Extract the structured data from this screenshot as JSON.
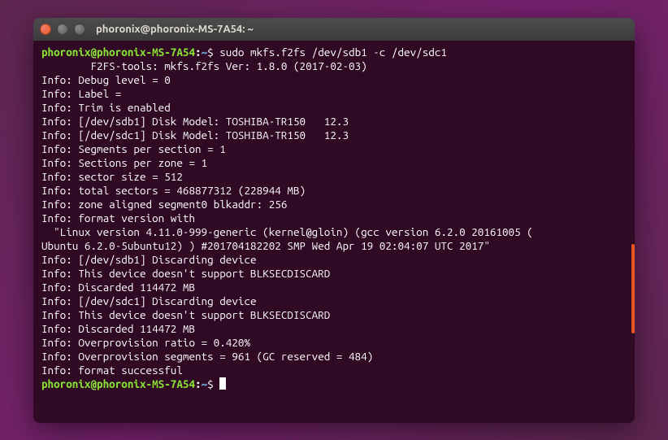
{
  "titlebar": {
    "title": "phoronix@phoronix-MS-7A54: ~"
  },
  "prompt": {
    "user_host": "phoronix@phoronix-MS-7A54",
    "colon": ":",
    "path": "~",
    "dollar": "$"
  },
  "command": "sudo mkfs.f2fs /dev/sdb1 -c /dev/sdc1",
  "output": [
    "",
    "        F2FS-tools: mkfs.f2fs Ver: 1.8.0 (2017-02-03)",
    "",
    "Info: Debug level = 0",
    "Info: Label = ",
    "Info: Trim is enabled",
    "Info: [/dev/sdb1] Disk Model: TOSHIBA-TR150   12.3",
    "Info: [/dev/sdc1] Disk Model: TOSHIBA-TR150   12.3",
    "Info: Segments per section = 1",
    "Info: Sections per zone = 1",
    "Info: sector size = 512",
    "Info: total sectors = 468877312 (228944 MB)",
    "Info: zone aligned segment0 blkaddr: 256",
    "Info: format version with",
    "  \"Linux version 4.11.0-999-generic (kernel@gloin) (gcc version 6.2.0 20161005 (",
    "Ubuntu 6.2.0-5ubuntu12) ) #201704182202 SMP Wed Apr 19 02:04:07 UTC 2017\"",
    "Info: [/dev/sdb1] Discarding device",
    "Info: This device doesn't support BLKSECDISCARD",
    "Info: Discarded 114472 MB",
    "Info: [/dev/sdc1] Discarding device",
    "Info: This device doesn't support BLKSECDISCARD",
    "Info: Discarded 114472 MB",
    "Info: Overprovision ratio = 0.420%",
    "Info: Overprovision segments = 961 (GC reserved = 484)",
    "Info: format successful"
  ]
}
